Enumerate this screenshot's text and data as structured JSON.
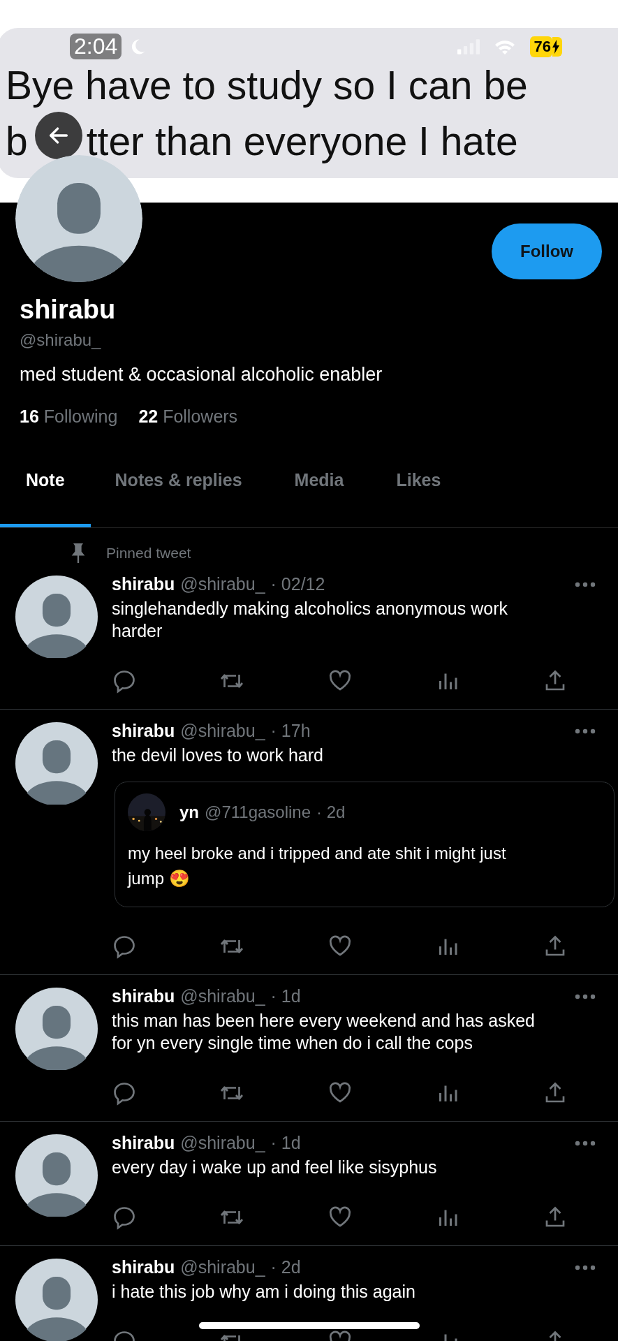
{
  "status_bar": {
    "time": "2:04",
    "battery": "76"
  },
  "banner": {
    "line_1": "Bye have to study so I can be",
    "line_2_start": "b",
    "line_2_rest": "tter than everyone I hate"
  },
  "profile": {
    "name": "shirabu",
    "handle": "@shirabu_",
    "bio": "med student & occasional alcoholic enabler",
    "following_count": "16",
    "following_label": "Following",
    "followers_count": "22",
    "followers_label": "Followers",
    "follow_button": "Follow"
  },
  "tabs": [
    {
      "label": "Note",
      "selected": true
    },
    {
      "label": "Notes & replies",
      "selected": false
    },
    {
      "label": "Media",
      "selected": false
    },
    {
      "label": "Likes",
      "selected": false
    }
  ],
  "pinned_label": "Pinned tweet",
  "tweets": [
    {
      "name": "shirabu",
      "handle": "@shirabu_",
      "time": "· 02/12",
      "text": "singlehandedly making alcoholics anonymous work harder"
    },
    {
      "name": "shirabu",
      "handle": "@shirabu_",
      "time": "· 17h",
      "text": "the devil loves to work hard",
      "quote": {
        "name": "yn",
        "handle": "@711gasoline",
        "time": "· 2d",
        "text": "my heel broke and i tripped and ate shit i might just jump 😍"
      }
    },
    {
      "name": "shirabu",
      "handle": "@shirabu_",
      "time": "· 1d",
      "text": "this man has been here every weekend and has asked for yn every single time when do i call the cops"
    },
    {
      "name": "shirabu",
      "handle": "@shirabu_",
      "time": "· 1d",
      "text": "every day i wake up and feel like sisyphus"
    },
    {
      "name": "shirabu",
      "handle": "@shirabu_",
      "time": "· 2d",
      "text": "i hate this job why am i doing this again"
    }
  ]
}
